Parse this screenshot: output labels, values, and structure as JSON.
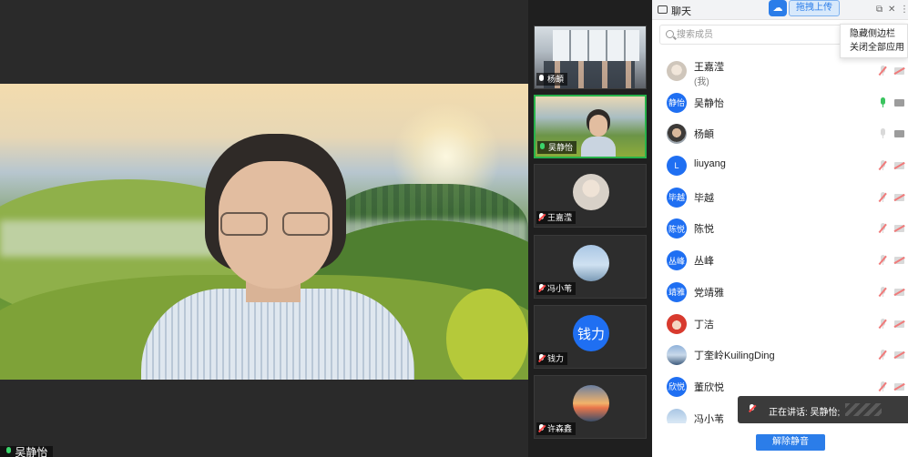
{
  "main": {
    "active_speaker_label": "吴静怡"
  },
  "thumbnails": [
    {
      "name": "杨頔",
      "type": "office",
      "mic": "on"
    },
    {
      "name": "吴静怡",
      "type": "video",
      "mic": "on-green",
      "active": true
    },
    {
      "name": "王嘉滢",
      "type": "photo-kid",
      "mic": "off"
    },
    {
      "name": "冯小苇",
      "type": "photo-sky",
      "mic": "off"
    },
    {
      "name": "钱力",
      "type": "avatar",
      "avatar_text": "钱力",
      "mic": "off"
    },
    {
      "name": "许森鑫",
      "type": "photo-sunset",
      "mic": "off"
    }
  ],
  "sidebar": {
    "title": "聊天",
    "upload_label": "拖拽上传",
    "cloud_icon": "baidu-cloud-icon",
    "search_placeholder": "搜索成员",
    "context_menu": [
      "隐藏侧边栏",
      "关闭全部应用"
    ],
    "members": [
      {
        "name": "王嘉滢",
        "sub": "(我)",
        "avatar_type": "photo-kid",
        "mic": "muted",
        "cam": "muted"
      },
      {
        "name": "吴静怡",
        "avatar_text": "静怡",
        "mic": "on",
        "cam": "on"
      },
      {
        "name": "杨頔",
        "avatar_type": "photo-man",
        "mic": "idle",
        "cam": "on"
      },
      {
        "name": "liuyang",
        "avatar_text": "L",
        "mic": "muted",
        "cam": "muted"
      },
      {
        "name": "毕越",
        "avatar_text": "毕越",
        "mic": "muted",
        "cam": "muted"
      },
      {
        "name": "陈悦",
        "avatar_text": "陈悦",
        "mic": "muted",
        "cam": "muted"
      },
      {
        "name": "丛峰",
        "avatar_text": "丛峰",
        "mic": "muted",
        "cam": "muted"
      },
      {
        "name": "党靖雅",
        "avatar_text": "靖雅",
        "mic": "muted",
        "cam": "muted"
      },
      {
        "name": "丁洁",
        "avatar_type": "photo-cartoon",
        "mic": "muted",
        "cam": "muted"
      },
      {
        "name": "丁奎岭KuilingDing",
        "avatar_type": "photo-landscape",
        "mic": "muted",
        "cam": "muted"
      },
      {
        "name": "董欣悦",
        "avatar_text": "欣悦",
        "mic": "muted",
        "cam": "muted"
      },
      {
        "name": "冯小苇",
        "avatar_type": "photo-sky",
        "mic": "muted",
        "cam": "muted"
      }
    ],
    "speaking_toast": "正在讲话: 吴静怡;",
    "unmute_all_label": "解除静音"
  },
  "colors": {
    "accent": "#2b7de9",
    "avatar_blue": "#1f6ff2",
    "active_green": "#27b24a",
    "muted_red": "#f07b7b"
  }
}
